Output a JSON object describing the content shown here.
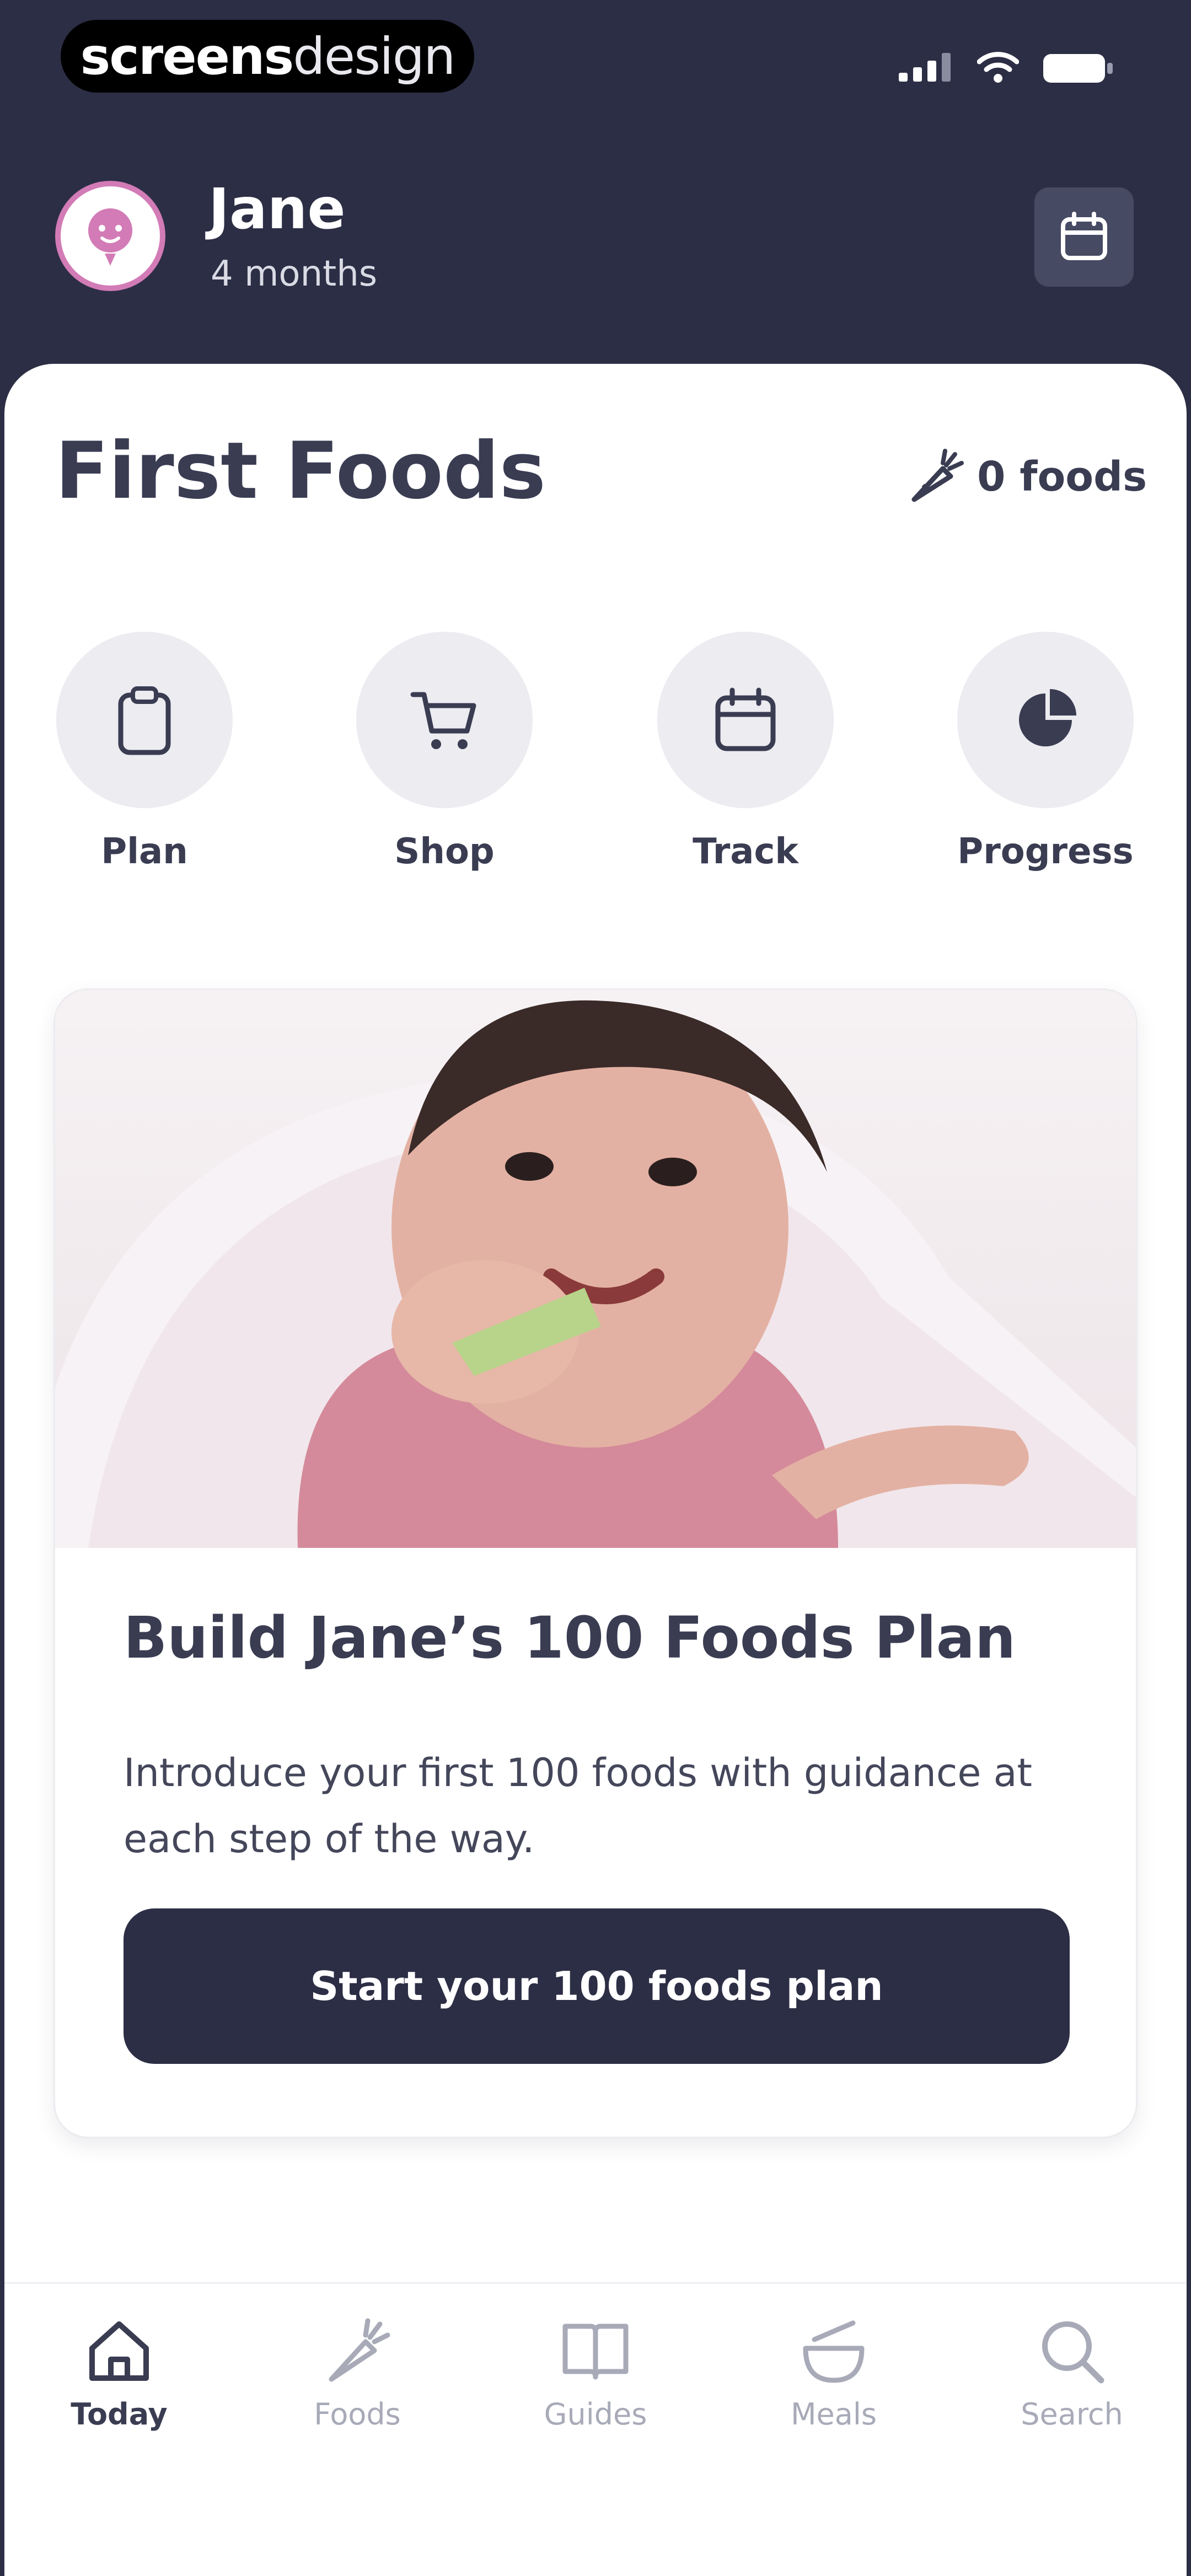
{
  "status_bar": {
    "brand_bold": "screens",
    "brand_light": "design",
    "icons": [
      "signal-icon",
      "wifi-icon",
      "battery-icon"
    ]
  },
  "header": {
    "child_name": "Jane",
    "child_age": "4 months",
    "avatar_icon": "baby-face-icon",
    "calendar_icon": "calendar-icon"
  },
  "main": {
    "title": "First Foods",
    "foods_count": "0 foods",
    "foods_icon": "carrot-icon"
  },
  "quick_actions": [
    {
      "label": "Plan",
      "icon": "clipboard-icon"
    },
    {
      "label": "Shop",
      "icon": "cart-icon"
    },
    {
      "label": "Track",
      "icon": "calendar-icon"
    },
    {
      "label": "Progress",
      "icon": "pie-chart-icon"
    }
  ],
  "promo": {
    "image": "baby-eating-photo",
    "title": "Build Jane’s 100 Foods Plan",
    "body": "Introduce your first 100 foods with guidance at each step of the way.",
    "cta": "Start your 100 foods plan"
  },
  "bottom_nav": [
    {
      "label": "Today",
      "icon": "home-icon",
      "active": true
    },
    {
      "label": "Foods",
      "icon": "carrot-icon",
      "active": false
    },
    {
      "label": "Guides",
      "icon": "book-icon",
      "active": false
    },
    {
      "label": "Meals",
      "icon": "bowl-icon",
      "active": false
    },
    {
      "label": "Search",
      "icon": "search-icon",
      "active": false
    }
  ],
  "colors": {
    "header_bg": "#2c2e45",
    "text_primary": "#3a3c52",
    "avatar_ring": "#d27bb6",
    "icon_circle": "#ececf1",
    "nav_inactive": "#a8aab8"
  }
}
